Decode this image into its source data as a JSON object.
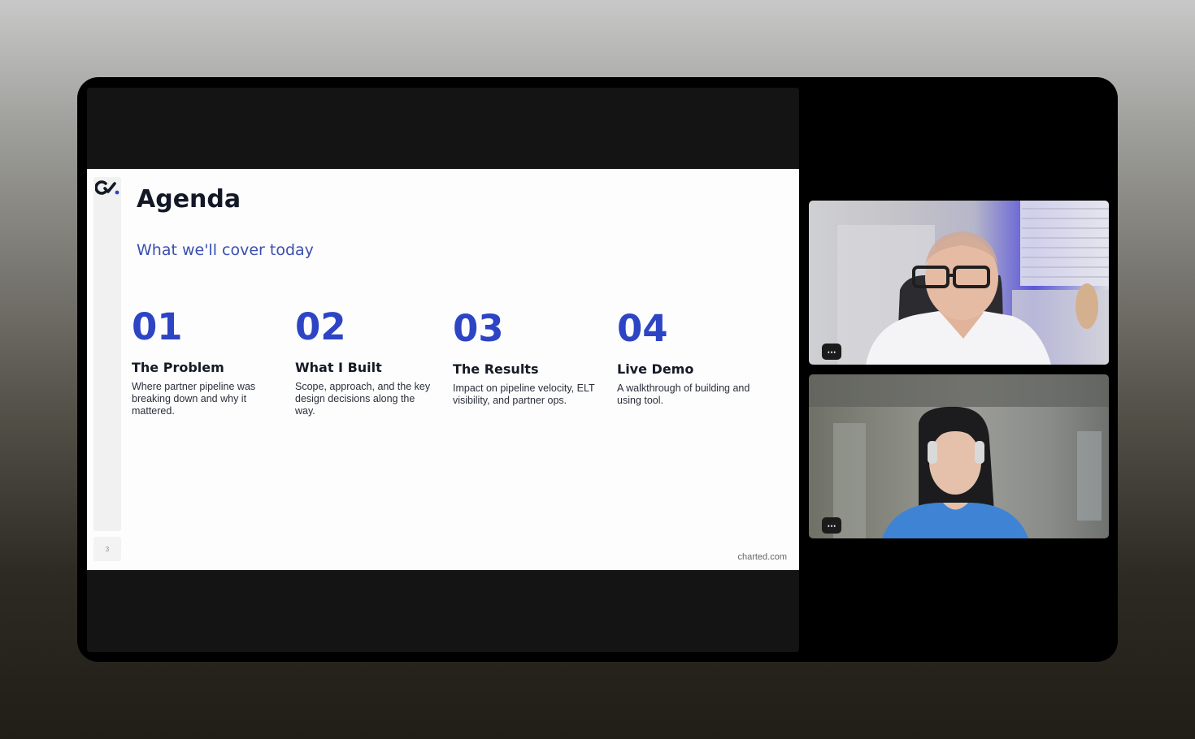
{
  "slide": {
    "title": "Agenda",
    "subtitle": "What we'll cover today",
    "page_number": "3",
    "footer": "charted.com",
    "items": [
      {
        "num": "01",
        "title": "The Problem",
        "desc": "Where partner pipeline was breaking down and why it mattered."
      },
      {
        "num": "02",
        "title": "What I Built",
        "desc": "Scope, approach, and the key design decisions along the way."
      },
      {
        "num": "03",
        "title": "The Results",
        "desc": "Impact on pipeline velocity, ELT visibility, and partner ops."
      },
      {
        "num": "04",
        "title": "Live Demo",
        "desc": "A walkthrough of building and using tool."
      }
    ]
  },
  "participants": {
    "more_label": "⋯"
  },
  "colors": {
    "accent": "#2d45c4",
    "subtitle": "#3a4fb0"
  },
  "icons": {
    "slide_logo": "charted-logo-icon",
    "tile_menu": "more-options-icon"
  }
}
